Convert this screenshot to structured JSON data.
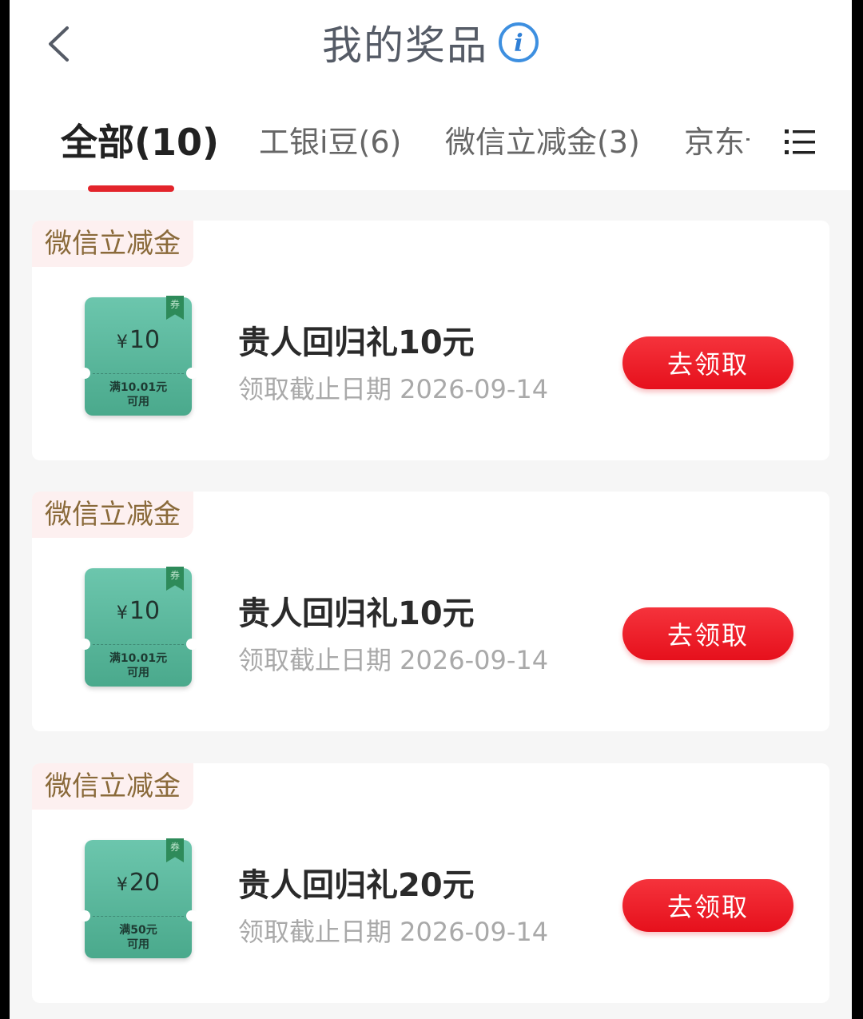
{
  "header": {
    "title": "我的奖品",
    "back_icon": "chevron-left-icon",
    "info_icon": "info-icon",
    "info_glyph": "i",
    "menu_icon": "list-icon"
  },
  "tabs": [
    {
      "label": "全部(10)",
      "active": true
    },
    {
      "label": "工银i豆(6)",
      "active": false
    },
    {
      "label": "微信立减金(3)",
      "active": false
    },
    {
      "label": "京东卡",
      "active": false
    }
  ],
  "colors": {
    "accent_red": "#e3242b",
    "coupon_green": "#5bb89c",
    "tag_bg": "#fdf0f0",
    "tag_text": "#8a6a3a"
  },
  "prizes": [
    {
      "tag": "微信立减金",
      "coupon_currency": "¥",
      "coupon_amount": "10",
      "coupon_condition": "满10.01元",
      "coupon_usable": "可用",
      "coupon_ribbon": "券",
      "title": "贵人回归礼10元",
      "deadline": "领取截止日期 2026-09-14",
      "action": "去领取"
    },
    {
      "tag": "微信立减金",
      "coupon_currency": "¥",
      "coupon_amount": "10",
      "coupon_condition": "满10.01元",
      "coupon_usable": "可用",
      "coupon_ribbon": "券",
      "title": "贵人回归礼10元",
      "deadline": "领取截止日期 2026-09-14",
      "action": "去领取"
    },
    {
      "tag": "微信立减金",
      "coupon_currency": "¥",
      "coupon_amount": "20",
      "coupon_condition": "满50元",
      "coupon_usable": "可用",
      "coupon_ribbon": "券",
      "title": "贵人回归礼20元",
      "deadline": "领取截止日期 2026-09-14",
      "action": "去领取"
    }
  ]
}
